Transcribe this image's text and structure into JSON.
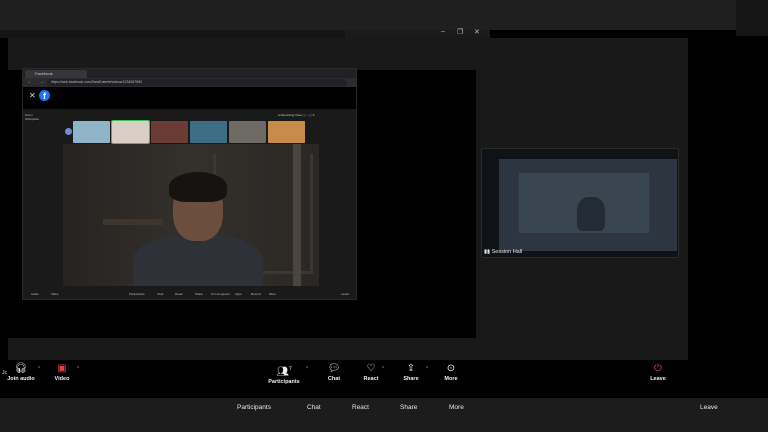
{
  "window": {
    "min": "–",
    "restore": "❐",
    "close": "✕"
  },
  "browser": {
    "tab_label": "Facebook",
    "url": "https://web.facebook.com/SaraDuterte/videos/1234567890",
    "nav": "← → ⟳",
    "fb_close": "✕",
    "fb_logo": "f"
  },
  "inner_zoom": {
    "brand": "Zoom Workplace",
    "controls": "● Recording  View ▢ – ▢ ✕",
    "thumb_colors": [
      "#8fb3c8",
      "#d9cfc4",
      "#6b3b36",
      "#3d6e86",
      "#6e6a64",
      "#c98b4a"
    ],
    "toolbar_items": [
      "Audio",
      "Video",
      "Participants",
      "Chat",
      "React",
      "Share",
      "AI Companion",
      "Apps",
      "Record",
      "More",
      "Leave"
    ]
  },
  "side_video": {
    "name": "Session Hall"
  },
  "toolbar": {
    "join_audio": "Join audio",
    "video": "Video",
    "participants": "Participants",
    "participants_count": "7",
    "chat": "Chat",
    "react": "React",
    "share": "Share",
    "more": "More",
    "leave": "Leave",
    "jc": "Jc"
  },
  "bottom": {
    "participants": "Participants",
    "chat": "Chat",
    "react": "React",
    "share": "Share",
    "more": "More",
    "leave": "Leave"
  }
}
